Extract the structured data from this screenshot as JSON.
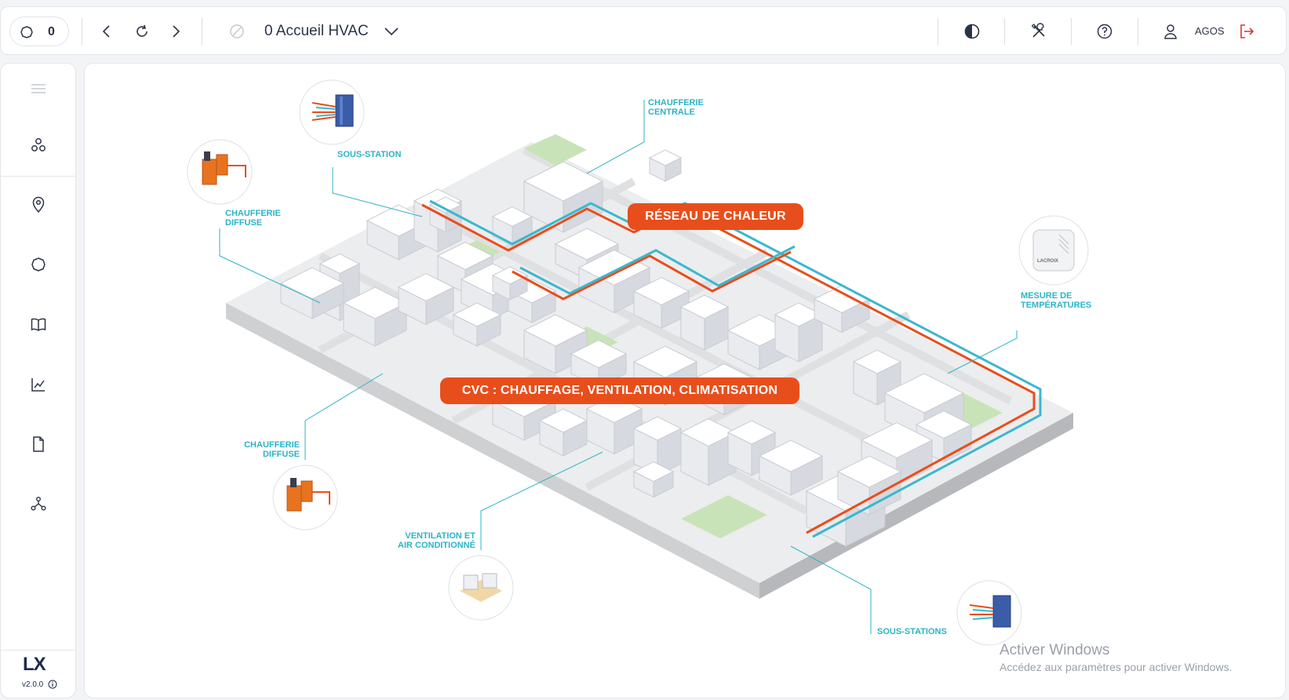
{
  "topbar": {
    "counter_value": "0",
    "page_title": "0 Accueil HVAC",
    "user_label": "AGOS"
  },
  "sidebar": {
    "logo": "LX",
    "version": "v2.0.0"
  },
  "map": {
    "banner_network": "RÉSEAU DE CHALEUR",
    "banner_hvac": "CVC : CHAUFFAGE, VENTILATION, CLIMATISATION",
    "label_substation": "SOUS-STATION",
    "label_central_boiler_l1": "CHAUFFERIE",
    "label_central_boiler_l2": "CENTRALE",
    "label_diffuse_top_l1": "CHAUFFERIE",
    "label_diffuse_top_l2": "DIFFUSE",
    "label_diffuse_bottom_l1": "CHAUFFERIE",
    "label_diffuse_bottom_l2": "DIFFUSE",
    "label_temp_l1": "MESURE DE",
    "label_temp_l2": "TEMPÉRATURES",
    "label_ventilation_l1": "VENTILATION ET",
    "label_ventilation_l2": "AIR CONDITIONNÉ",
    "label_substations": "SOUS-STATIONS",
    "sensor_brand": "LACROIX"
  },
  "watermark": {
    "line1": "Activer Windows",
    "line2": "Accédez aux paramètres pour activer Windows."
  },
  "colors": {
    "accent_orange": "#e84e1b",
    "accent_cyan": "#2bb3c6",
    "logout_red": "#d9343a"
  }
}
